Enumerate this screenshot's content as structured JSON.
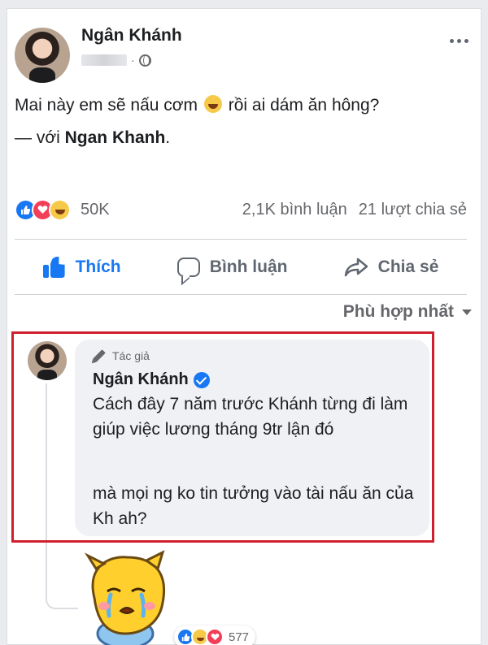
{
  "post": {
    "author": "Ngân Khánh",
    "meta_separator": "·",
    "text_line1_before": "Mai này em sẽ nấu cơm",
    "text_line1_after": "rồi ai dám ăn hông?",
    "text_line2_prefix": "— với",
    "tagged_name": "Ngan Khanh",
    "tagged_suffix": "."
  },
  "stats": {
    "reaction_count": "50K",
    "comments": "2,1K bình luận",
    "shares": "21 lượt chia sẻ"
  },
  "actions": {
    "like": "Thích",
    "comment": "Bình luận",
    "share": "Chia sẻ"
  },
  "sort": {
    "label": "Phù hợp nhất"
  },
  "comment": {
    "badge": "Tác giả",
    "author": "Ngân Khánh",
    "text1": "Cách đây 7 năm trước Khánh từng đi làm giúp việc lương tháng 9tr lận đó",
    "text2": "mà mọi ng ko tin tưởng vào tài nấu ăn của Kh ah?"
  },
  "reply": {
    "reaction_count": "577"
  },
  "colors": {
    "accent": "#1877f2",
    "highlight_border": "#d0202e",
    "love": "#f33e58",
    "haha": "#f7c948"
  },
  "icons": [
    "globe-icon",
    "more-icon",
    "like-icon",
    "comment-icon",
    "share-icon",
    "chevron-down-icon",
    "pencil-icon",
    "verified-icon"
  ]
}
